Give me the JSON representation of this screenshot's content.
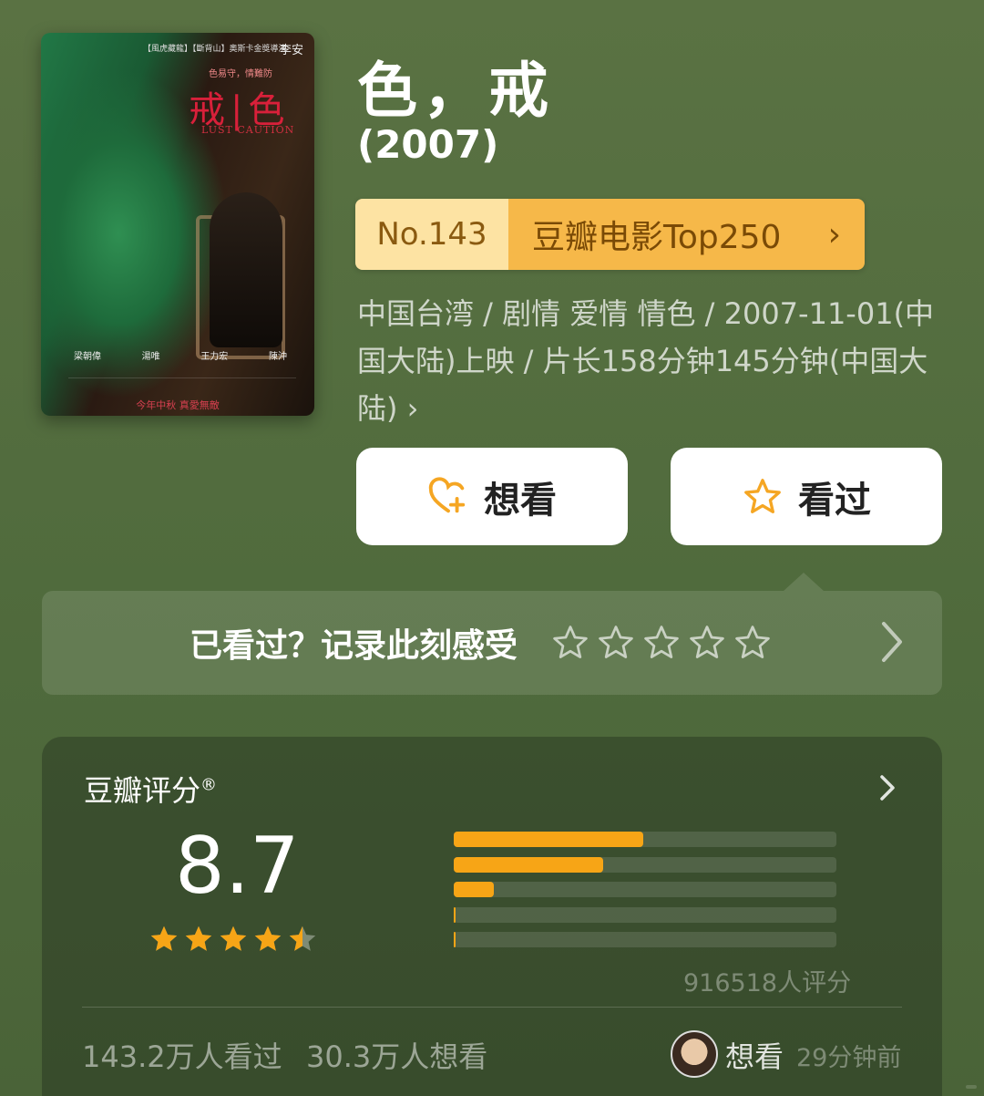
{
  "movie": {
    "title": "色，戒",
    "year": "(2007)",
    "rank_no": "No.143",
    "rank_label": "豆瓣电影Top250",
    "meta": "中国台湾 / 剧情 爱情 情色 / 2007-11-01(中国大陆)上映 / 片长158分钟145分钟(中国大陆) ›"
  },
  "poster": {
    "credit": "【風虎藏龍】【斷背山】奧斯卡金獎導演",
    "director": "李安",
    "tagline": "色易守，情難防",
    "title_cn": "戒|色",
    "title_en": "LUST CAUTION",
    "cast": [
      "梁朝偉",
      "湯唯",
      "王力宏",
      "陳沖"
    ],
    "bottom": "今年中秋 真愛無敵"
  },
  "actions": {
    "want_label": "想看",
    "seen_label": "看过",
    "rate_prompt": "已看过？记录此刻感受"
  },
  "rating": {
    "title": "豆瓣评分",
    "reg": "®",
    "score": "8.7",
    "stars_value": 4.5,
    "distribution": [
      49.5,
      39,
      10.5,
      0.5,
      0.5
    ],
    "count": "916518人评分",
    "seen": "143.2万人看过",
    "wish": "30.3万人想看",
    "friend_action": "想看",
    "friend_time": "29分钟前"
  },
  "colors": {
    "accent": "#f7a516",
    "background": "#556e40"
  }
}
